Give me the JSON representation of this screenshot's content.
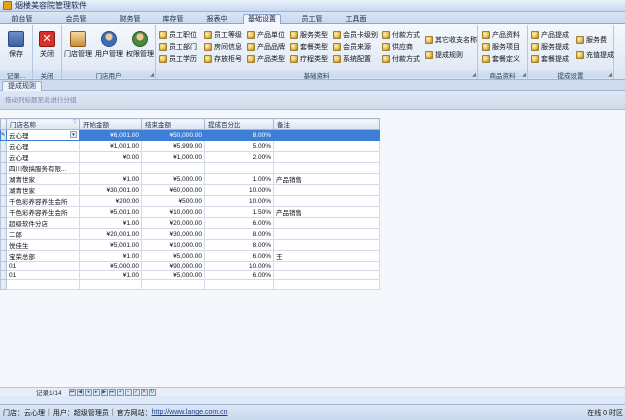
{
  "app": {
    "title": "烟楼美容院管理软件"
  },
  "tabs": [
    {
      "label": "前台管理",
      "active": false
    },
    {
      "label": "会员管理",
      "active": false
    },
    {
      "label": "财务管理",
      "active": false
    },
    {
      "label": "库存管理",
      "active": false
    },
    {
      "label": "报表中心",
      "active": false
    },
    {
      "label": "基础设置",
      "active": true
    },
    {
      "label": "员工管理",
      "active": false
    },
    {
      "label": "工具面板",
      "active": false
    }
  ],
  "ribbon": {
    "groups": {
      "record": {
        "label": "记录..."
      },
      "close": {
        "label": "关闭"
      },
      "store_user": {
        "label": "门店用户"
      },
      "basic_data": {
        "label": "基础资料"
      },
      "product_data": {
        "label": "商品资料"
      },
      "commission": {
        "label": "提成设置"
      }
    },
    "save": "保存",
    "close": "关闭",
    "store_mgmt": "门店管理",
    "user_mgmt": "用户管理",
    "perm_mgmt": "权限管理",
    "basic_items": [
      "员工职位",
      "员工部门",
      "员工学历",
      "员工等级",
      "房间信息",
      "存放柜号",
      "产品单位",
      "产品品牌",
      "产品类型",
      "服务类型",
      "套餐类型",
      "疗程类型",
      "会员卡级别",
      "会员来源",
      "系统配置",
      "付款方式",
      "供应商",
      "付款方式",
      "其它收支名称",
      "提成规则"
    ],
    "product_items": [
      "产品资料",
      "服务项目",
      "套餐定义"
    ],
    "commission_items": [
      "产品提成",
      "服务提成",
      "套餐提成",
      "服务费",
      "充值提成"
    ]
  },
  "subtab": {
    "label": "提成规则"
  },
  "group_hint": "拖动列标题至此进行分组",
  "grid": {
    "columns": [
      "门店名称",
      "开始金额",
      "结束金额",
      "提成百分比",
      "备注"
    ],
    "rows": [
      [
        "云心理",
        "¥6,001.00",
        "¥50,000.00",
        "8.00%",
        ""
      ],
      [
        "云心理",
        "¥1,001.00",
        "¥5,999.00",
        "5.00%",
        ""
      ],
      [
        "云心理",
        "¥0.00",
        "¥1,000.00",
        "2.00%",
        ""
      ],
      [
        "四川敬搞服务有限...",
        "",
        "",
        "",
        ""
      ],
      [
        "湖青世家",
        "¥1.00",
        "¥5,000.00",
        "1.00%",
        "产品销售"
      ],
      [
        "湖青世家",
        "¥30,001.00",
        "¥60,000.00",
        "10.00%",
        ""
      ],
      [
        "千色彩养容养生会所",
        "¥200.00",
        "¥500.00",
        "10.00%",
        ""
      ],
      [
        "千色彩养容养生会所",
        "¥5,001.00",
        "¥10,000.00",
        "1.50%",
        "产品销售"
      ],
      [
        "超级软件分店",
        "¥1.00",
        "¥20,000.00",
        "6.00%",
        ""
      ],
      [
        "二郎",
        "¥20,001.00",
        "¥30,000.00",
        "8.00%",
        ""
      ],
      [
        "悦佳生",
        "¥5,001.00",
        "¥10,000.00",
        "8.00%",
        ""
      ],
      [
        "宝荣总部",
        "¥1.00",
        "¥5,000.00",
        "6.00%",
        "王"
      ],
      [
        "01",
        "¥5,000.00",
        "¥90,000.00",
        "10.00%",
        ""
      ],
      [
        "01",
        "¥1.00",
        "¥5,000.00",
        "6.00%",
        ""
      ]
    ]
  },
  "navigator": {
    "text": "记录1/14"
  },
  "status": {
    "store": "门店：云心理",
    "user": "用户：超级管理员",
    "website_label": "官方网站：",
    "website": "http://www.lange.com.cn",
    "right": "在线 0 时区"
  }
}
